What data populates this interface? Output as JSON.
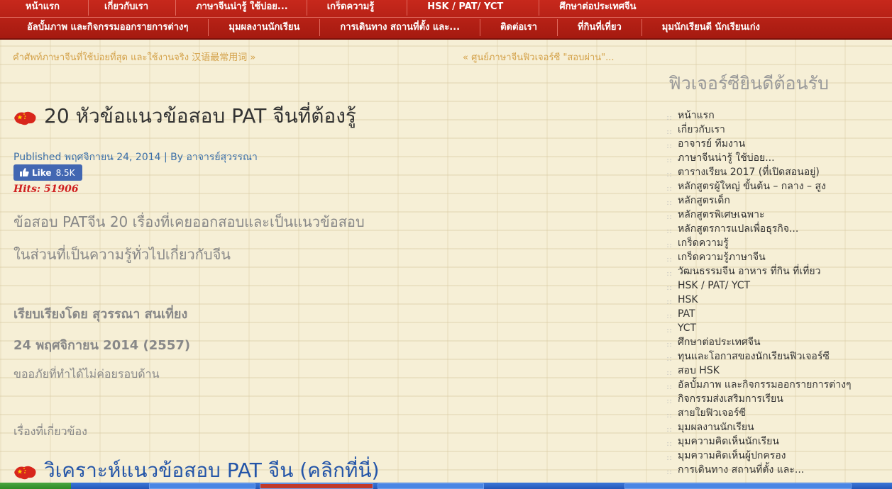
{
  "nav": {
    "row1": [
      "หน้าแรก",
      "เกี่ยวกับเรา",
      "ภาษาจีนน่ารู้ ใช้บ่อย...",
      "เกร็ดความรู้",
      "HSK / PAT/ YCT",
      "ศึกษาต่อประเทศจีน"
    ],
    "row2": [
      "อัลบั้มภาพ และกิจกรรมออกรายการต่างๆ",
      "มุมผลงานนักเรียน",
      "การเดินทาง สถานที่ตั้ง และ...",
      "ติดต่อเรา",
      "ที่กินที่เที่ยว",
      "มุมนักเรียนดี นักเรียนเก่ง"
    ]
  },
  "postnav": {
    "prev": "คำศัพท์ภาษาจีนที่ใช้บ่อยที่สุด และใช้งานจริง 汉语最常用词 »",
    "next": "« ศูนย์ภาษาจีนฟิวเจอร์ซี \"สอบผ่าน\"..."
  },
  "post": {
    "title": "20 หัวข้อแนวข้อสอบ PAT จีนที่ต้องรู้",
    "meta": "Published พฤศจิกายน 24, 2014 | By อาจารย์สุวรรณา",
    "like_label": "Like",
    "like_count": "8.5K",
    "hits": "Hits: 51906",
    "para1": "ข้อสอบ PATจีน 20 เรื่องที่เคยออกสอบและเป็นแนวข้อสอบ",
    "para2": "ในส่วนที่เป็นความรู้ทั่วไปเกี่ยวกับจีน",
    "para3": "เรียบเรียงโดย สุวรรณา สนเที่ยง",
    "para4": "24 พฤศจิกายน 2014 (2557)",
    "para5": "ขออภัยที่ทำได้ไม่ค่อยรอบด้าน",
    "para6": "เรื่องที่เกี่ยวข้อง",
    "related": "วิเคราะห์แนวข้อสอบ PAT จีน (คลิกที่นี่)"
  },
  "sidebar": {
    "title": "ฟิวเจอร์ซียินดีต้อนรับ",
    "items": [
      "หน้าแรก",
      "เกี่ยวกับเรา",
      "อาจารย์ ทีมงาน",
      "ภาษาจีนน่ารู้ ใช้บ่อย...",
      "ตารางเรียน 2017 (ที่เปิดสอนอยู่)",
      "หลักสูตรผู้ใหญ่ ขั้นต้น – กลาง – สูง",
      "หลักสูตรเด็ก",
      "หลักสูตรพิเศษเฉพาะ",
      "หลักสูตรการแปลเพื่อธุรกิจ...",
      "เกร็ดความรู้",
      "เกร็ดความรู้ภาษาจีน",
      "วัฒนธรรมจีน อาหาร ที่กิน ที่เที่ยว",
      "HSK / PAT/ YCT",
      "HSK",
      "PAT",
      "YCT",
      "ศึกษาต่อประเทศจีน",
      "ทุนและโอกาสของนักเรียนฟิวเจอร์ซี",
      "สอบ HSK",
      "อัลบั้มภาพ และกิจกรรมออกรายการต่างๆ",
      "กิจกรรมส่งเสริมการเรียน",
      "สายใยฟิวเจอร์ซี",
      "มุมผลงานนักเรียน",
      "มุมความคิดเห็นนักเรียน",
      "มุมความคิดเห็นผู้ปกครอง",
      "การเดินทาง สถานที่ตั้ง และ..."
    ]
  },
  "colors": {
    "nav_bg": "#b8221a",
    "link_gold": "#d4a24a",
    "meta_blue": "#3b6fa8",
    "hits_red": "#d02020",
    "fb_blue": "#4267b2"
  }
}
